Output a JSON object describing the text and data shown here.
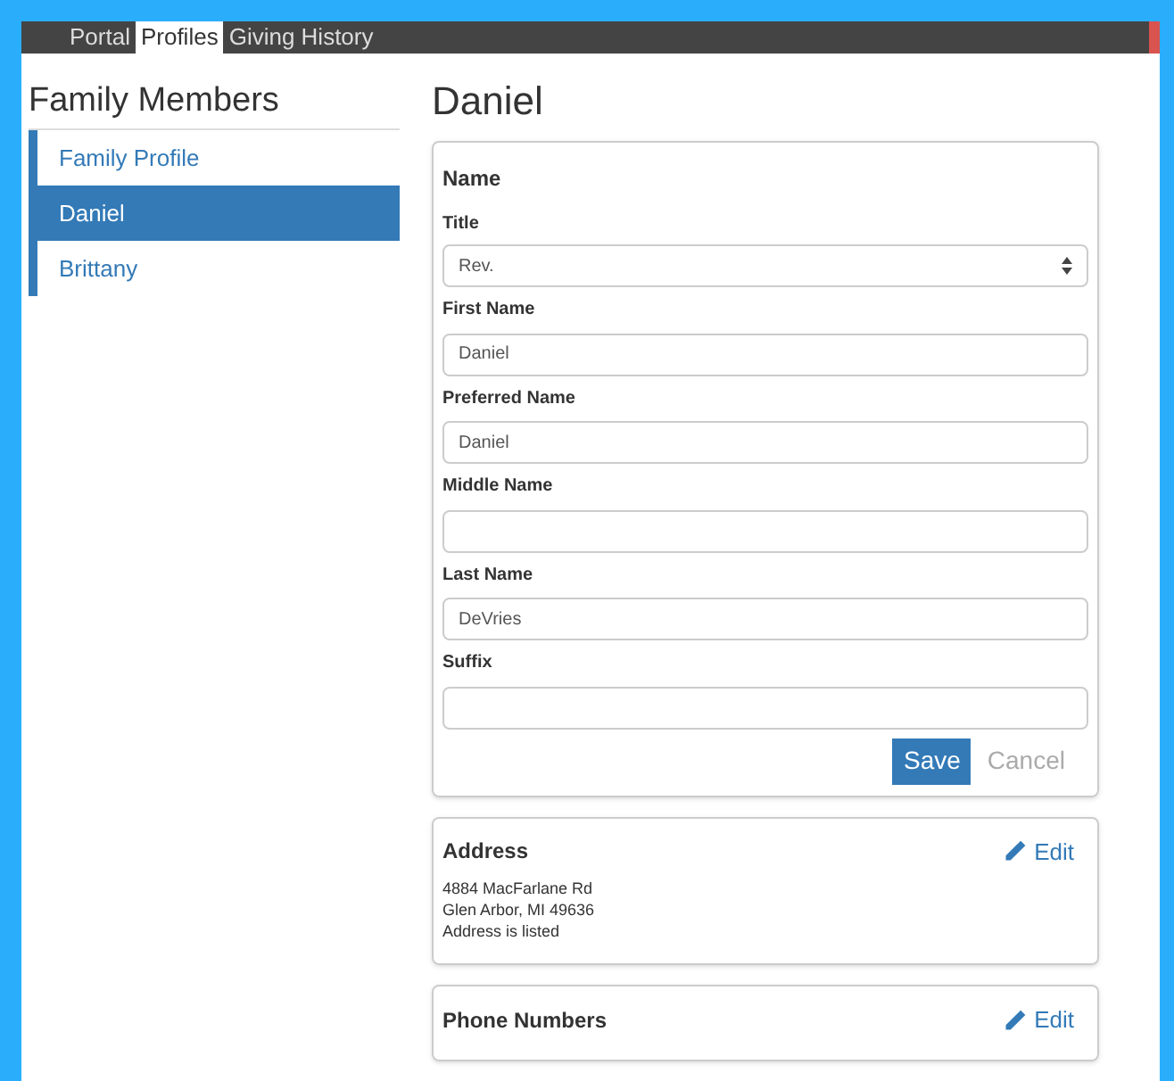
{
  "nav": {
    "tabs": [
      {
        "label": "Portal",
        "selected": false
      },
      {
        "label": "Profiles",
        "selected": true
      },
      {
        "label": "Giving History",
        "selected": false
      }
    ]
  },
  "sidebar": {
    "title": "Family Members",
    "items": [
      {
        "label": "Family Profile",
        "selected": false
      },
      {
        "label": "Daniel",
        "selected": true
      },
      {
        "label": "Brittany",
        "selected": false
      }
    ]
  },
  "page_title": "Daniel",
  "name_card": {
    "title": "Name",
    "fields": [
      {
        "kind": "select",
        "label": "Title",
        "value": "Rev."
      },
      {
        "kind": "text",
        "label": "First Name",
        "value": "Daniel"
      },
      {
        "kind": "text",
        "label": "Preferred Name",
        "value": "Daniel"
      },
      {
        "kind": "text",
        "label": "Middle Name"
      },
      {
        "kind": "text",
        "label": "Last Name",
        "value": "DeVries"
      },
      {
        "kind": "text",
        "label": "Suffix"
      }
    ],
    "save": "Save",
    "cancel": "Cancel"
  },
  "cards": [
    {
      "title": "Address",
      "edit": "Edit",
      "lines": [
        "4884 MacFarlane Rd",
        "Glen Arbor, MI 49636",
        "Address is listed"
      ]
    },
    {
      "title": "Phone Numbers",
      "edit": "Edit"
    }
  ]
}
